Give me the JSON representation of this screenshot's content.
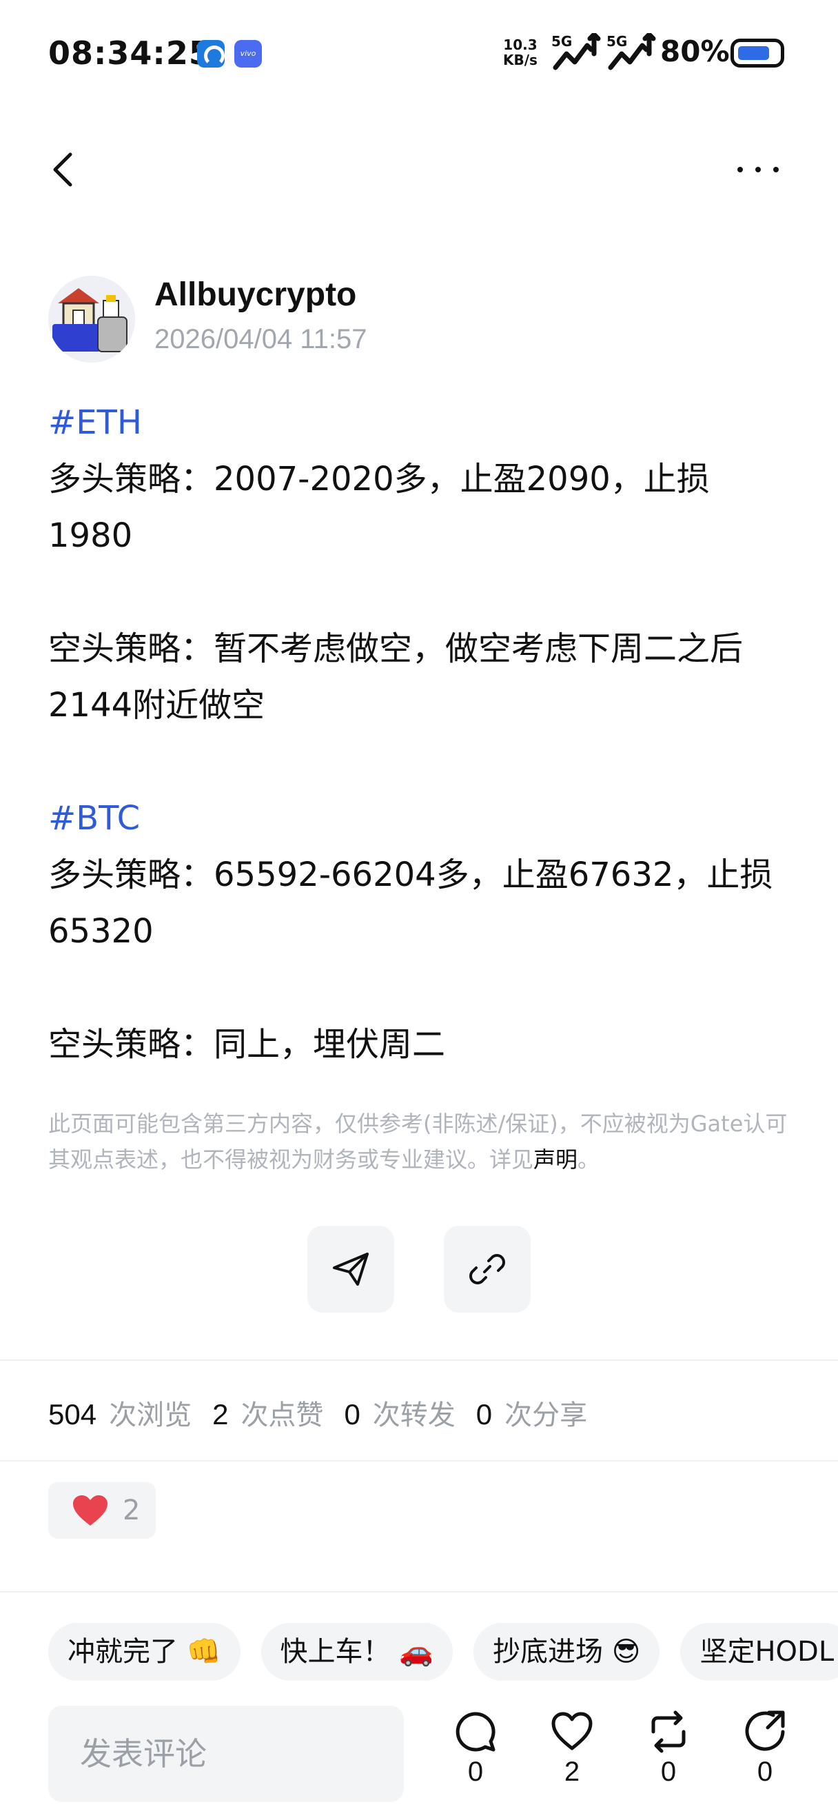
{
  "status_bar": {
    "time": "08:34:25",
    "net_speed_value": "10.3",
    "net_speed_unit": "KB/s",
    "signal_1": "5G",
    "signal_2": "5G",
    "battery_percent": "80%",
    "battery_level": 0.8,
    "app_badge_label": "vivo"
  },
  "nav": {
    "back_icon": "chevron-left-icon",
    "more_icon": "more-horizontal-icon"
  },
  "author": {
    "name": "Allbuycrypto",
    "timestamp": "2026/04/04 11:57"
  },
  "post": {
    "tag_eth": "#ETH",
    "eth_long": "多头策略：2007-2020多，止盈2090，止损1980",
    "eth_short": "空头策略：暂不考虑做空，做空考虑下周二之后2144附近做空",
    "tag_btc": "#BTC",
    "btc_long": "多头策略：65592-66204多，止盈67632，止损65320",
    "btc_short": "空头策略：同上，埋伏周二"
  },
  "disclaimer": {
    "text": "此页面可能包含第三方内容，仅供参考(非陈述/保证)，不应被视为Gate认可其观点表述，也不得被视为财务或专业建议。详见",
    "link": "声明",
    "end": "。"
  },
  "stats": {
    "views": "504",
    "views_label": "次浏览",
    "likes": "2",
    "likes_label": "次点赞",
    "reposts": "0",
    "reposts_label": "次转发",
    "shares": "0",
    "shares_label": "次分享"
  },
  "reaction": {
    "icon": "heart-icon",
    "count": "2"
  },
  "quick_replies": [
    "冲就完了 👊",
    "快上车！ 🚗",
    "抄底进场 😎",
    "坚定HODL"
  ],
  "bottom_bar": {
    "comment_placeholder": "发表评论",
    "comment_count": "0",
    "like_count": "2",
    "repost_count": "0",
    "share_count": "0"
  },
  "colors": {
    "hashtag": "#2e5bdc",
    "heart": "#e8434f",
    "battery_fill": "#2e6be6",
    "chip_bg": "#f3f4f6"
  }
}
